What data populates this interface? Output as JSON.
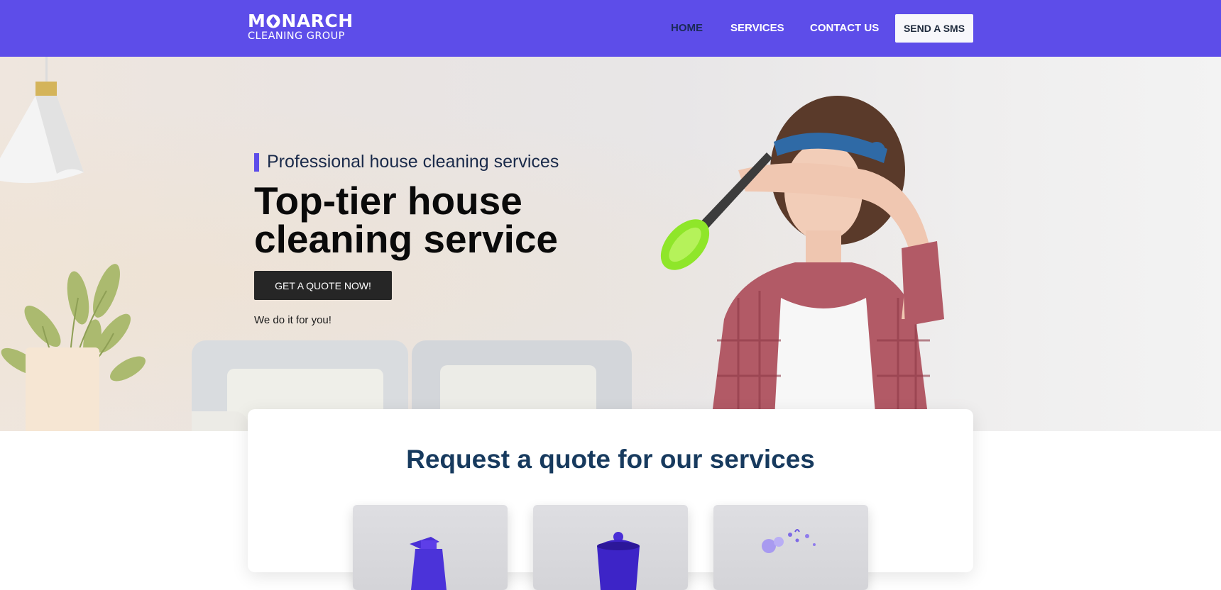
{
  "brand": {
    "name_part1": "M",
    "name_part2": "NARCH",
    "subtitle": "CLEANING GROUP"
  },
  "nav": {
    "items": [
      {
        "label": "HOME",
        "active": true
      },
      {
        "label": "SERVICES",
        "active": false
      },
      {
        "label": "CONTACT US",
        "active": false
      }
    ],
    "cta_label": "SEND A SMS"
  },
  "hero": {
    "eyebrow": "Professional house cleaning services",
    "title_line1": "Top-tier house",
    "title_line2": "cleaning service",
    "button_label": "GET A QUOTE NOW!",
    "tagline": "We do it for you!"
  },
  "quote_section": {
    "title": "Request a quote for our services",
    "services": [
      {
        "icon": "spray-bottle-icon"
      },
      {
        "icon": "bucket-icon"
      },
      {
        "icon": "bubbles-icon"
      }
    ]
  },
  "colors": {
    "brand_purple": "#5d4de9",
    "nav_active": "#1b2a57",
    "dark_button": "#262626",
    "heading_blue": "#173a5e"
  }
}
